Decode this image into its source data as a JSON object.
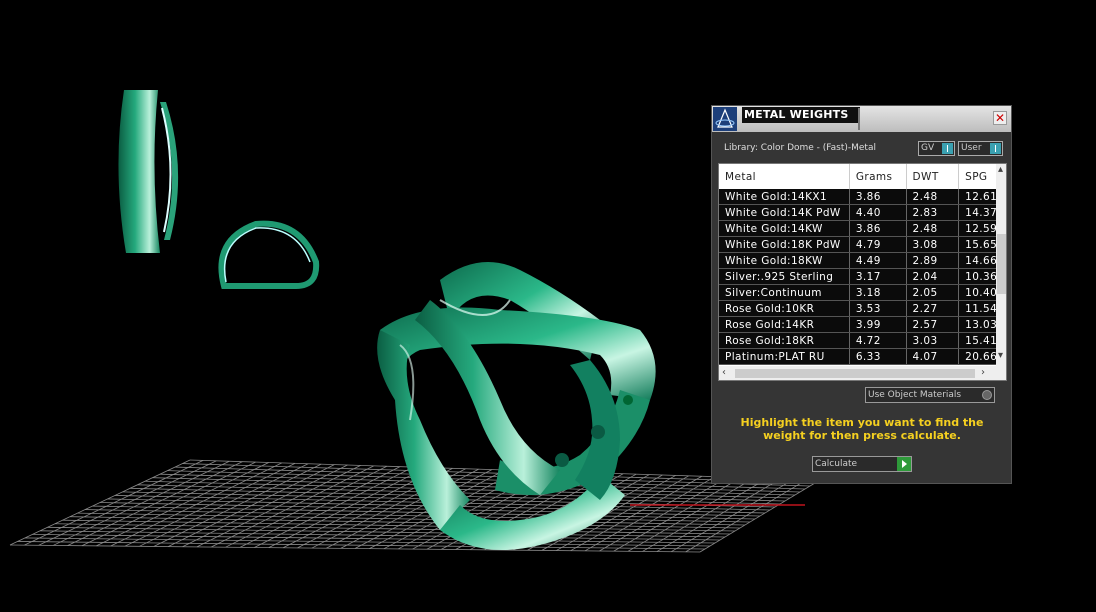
{
  "panel": {
    "title": "METAL WEIGHTS",
    "close_icon": "close-icon",
    "library_label": "Library: Color Dome - (Fast)-Metal",
    "toggle_gv": "GV",
    "toggle_user": "User",
    "columns": [
      "Metal",
      "Grams",
      "DWT",
      "SPG"
    ],
    "rows": [
      [
        "White Gold:14KX1",
        "3.86",
        "2.48",
        "12.61"
      ],
      [
        "White Gold:14K PdW",
        "4.40",
        "2.83",
        "14.37"
      ],
      [
        "White Gold:14KW",
        "3.86",
        "2.48",
        "12.59"
      ],
      [
        "White Gold:18K PdW",
        "4.79",
        "3.08",
        "15.65"
      ],
      [
        "White Gold:18KW",
        "4.49",
        "2.89",
        "14.66"
      ],
      [
        "Silver:.925 Sterling",
        "3.17",
        "2.04",
        "10.36"
      ],
      [
        "Silver:Continuum",
        "3.18",
        "2.05",
        "10.40"
      ],
      [
        "Rose Gold:10KR",
        "3.53",
        "2.27",
        "11.54"
      ],
      [
        "Rose Gold:14KR",
        "3.99",
        "2.57",
        "13.03"
      ],
      [
        "Rose Gold:18KR",
        "4.72",
        "3.03",
        "15.41"
      ],
      [
        "Platinum:PLAT RU",
        "6.33",
        "4.07",
        "20.66"
      ]
    ],
    "use_object_materials": "Use Object Materials",
    "instructions": "Highlight the item you want to find the weight for then press calculate.",
    "calculate_label": "Calculate"
  },
  "colors": {
    "ring_green": "#1f9a72",
    "instructions_yellow": "#f5d020",
    "grid_line": "#8a8a8a"
  }
}
